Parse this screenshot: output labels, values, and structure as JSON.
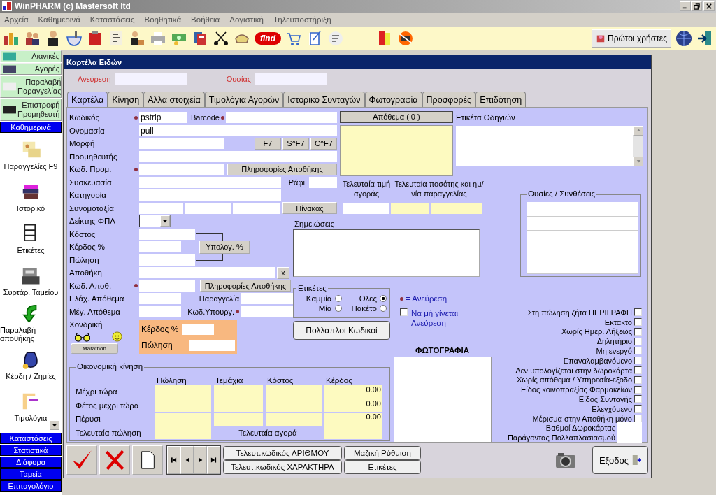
{
  "window": {
    "title": "WinPHARM (c) Mastersoft ltd"
  },
  "menu": [
    "Αρχεία",
    "Καθημερινά",
    "Καταστάσεις",
    "Βοηθητικά",
    "Βοήθεια",
    "Λογιστική",
    "Τηλευποστήριξη"
  ],
  "toolbar": {
    "find_button": "find",
    "first_users_button": "Πρώτοι χρήστες"
  },
  "sidebar": {
    "quick_buttons": [
      "Λιανικές",
      "Αγορές",
      "Παραλαβή Παραγγελίας",
      "Επιστροφή Προμηθευτή"
    ],
    "groups": [
      {
        "label": "Καθημερινά",
        "items": [
          "Παραγγελίες F9",
          "Ιστορικό",
          "Ετικέτες",
          "Συρτάρι Ταμείου",
          "Παραλαβή αποθήκης",
          "Κέρδη / Ζημίες",
          "Τιμολόγια"
        ]
      },
      {
        "label": "Καταστάσεις"
      },
      {
        "label": "Στατιστικά"
      },
      {
        "label": "Διάφορα"
      },
      {
        "label": "Ταμεία"
      },
      {
        "label": "Επιταγολόγιο"
      }
    ]
  },
  "form": {
    "title": "Καρτέλα Ειδών",
    "search": [
      {
        "label": "Ανεύρεση"
      },
      {
        "label": "Ουσίας"
      }
    ],
    "tabs": [
      {
        "label": "Καρτέλα",
        "selected": true
      },
      {
        "label": "Κίνηση",
        "selected": false
      },
      {
        "label": "Αλλα στοιχεία",
        "selected": false
      },
      {
        "label": "Τιμολόγια Αγορών",
        "selected": false
      },
      {
        "label": "Ιστορικό Συνταγών",
        "selected": false
      },
      {
        "label": "Φωτογραφία",
        "selected": false
      },
      {
        "label": "Προσφορές",
        "selected": false
      },
      {
        "label": "Επιδότηση",
        "selected": false
      }
    ]
  },
  "card": {
    "code": {
      "label": "Κωδικός",
      "value": "pstrip",
      "search_key": true
    },
    "barcode": {
      "label": "Barcode",
      "search_key": true
    },
    "name": {
      "label": "Ονομασία",
      "value": "pull"
    },
    "form_field": {
      "label": "Μορφή"
    },
    "form_buttons": [
      "F7",
      "S^F7",
      "C^F7"
    ],
    "supplier": {
      "label": "Προμηθευτής"
    },
    "supplier_code": {
      "label": "Κωδ. Προμ.",
      "search_key": true
    },
    "warehouse_info_button": "Πληροφορίες Αποθήκης",
    "packaging": {
      "label": "Συσκευασία"
    },
    "shelf": {
      "label": "Ράφι"
    },
    "category": {
      "label": "Κατηγορία"
    },
    "class": {
      "label": "Συνομοταξία"
    },
    "table_button": "Πίνακας",
    "vat": {
      "label": "Δείκτης ΦΠΑ"
    },
    "cost": {
      "label": "Κόστος"
    },
    "margin": {
      "label": "Κέρδος %"
    },
    "price": {
      "label": "Πώληση"
    },
    "calc_button": "Υπολογ. %",
    "warehouse": {
      "label": "Αποθήκη",
      "clear_button": "x"
    },
    "warehouse_code": {
      "label": "Κωδ. Αποθ.",
      "search_key": true
    },
    "warehouse_info_button_2": "Πληροφορίες Αποθήκης",
    "min_stock": {
      "label": "Ελάχ. Απόθεμα"
    },
    "order": {
      "label": "Παραγγελία"
    },
    "max_stock": {
      "label": "Μέγ. Απόθεμα"
    },
    "ministry_code": {
      "label": "Κωδ.Υπουργ.",
      "search_key": true
    },
    "wholesale": {
      "label": "Χονδρική",
      "margin_label": "Κέρδος %",
      "price_label": "Πώληση"
    },
    "marathon_button": "Marathon",
    "stock": {
      "label": "Απόθεμα ( 0 )"
    },
    "instructions": {
      "label": "Ετικέτα Οδηγιών"
    },
    "last_price": {
      "label": "Τελευταία τιμή αγοράς"
    },
    "last_order": {
      "label": "Τελευταία ποσότης και ημ/νία παραγγελίας"
    },
    "notes": {
      "label": "Σημειώσεις"
    },
    "labels_group": {
      "title": "Ετικέτες",
      "options": [
        {
          "label": "Καμμία",
          "selected": false
        },
        {
          "label": "Ολες",
          "selected": true
        },
        {
          "label": "Μία",
          "selected": false
        },
        {
          "label": "Πακέτο",
          "selected": false
        }
      ]
    },
    "legend": "= Ανεύρεση",
    "no_search": {
      "label": "Να μή γίνεται Ανεύρεση",
      "checked": false
    },
    "multi_codes_button": "Πολλαπλοί Κωδικοί",
    "substances": {
      "title": "Ουσίες / Συνθέσεις"
    },
    "photo": {
      "title": "ΦΩΤΟΓΡΑΦΙΑ"
    },
    "flags": [
      {
        "label": "Στη πώληση ζήτα ΠΕΡΙΓΡΑΦΗ",
        "checked": false
      },
      {
        "label": "Εκτακτο",
        "checked": false
      },
      {
        "label": "Χωρίς Ημερ. Λήξεως",
        "checked": false
      },
      {
        "label": "Δηλητήριο",
        "checked": false
      },
      {
        "label": "Μη ενεργό",
        "checked": false
      },
      {
        "label": "Επαναλαμβανόμενο",
        "checked": false
      },
      {
        "label": "Δεν υπολογίζεται στην δωροκάρτα",
        "checked": false
      },
      {
        "label": "Χωρίς απόθεμα / Υπηρεσία-εξοδο",
        "checked": false
      },
      {
        "label": "Είδος κοινοπραξίας Φαρμακείων",
        "checked": false
      },
      {
        "label": "Είδος Συνταγής",
        "checked": false
      },
      {
        "label": "Ελεγχόμενο",
        "checked": false
      },
      {
        "label": "Μέρισμα στην Αποθήκη μόνο",
        "checked": false
      }
    ],
    "points": {
      "label": "Βαθμοί Δωροκάρτας"
    },
    "multiplier": {
      "label": "Παράγοντας Πολλαπλασιασμού"
    },
    "finance": {
      "title": "Οικονομική κίνηση",
      "columns": [
        "Πώληση",
        "Τεμάχια",
        "Κόστος",
        "Κέρδος"
      ],
      "rows": [
        {
          "label": "Μέχρι τώρα",
          "profit": "0.00"
        },
        {
          "label": "Φέτος μεχρι τώρα",
          "profit": "0.00"
        },
        {
          "label": "Πέρυσι",
          "profit": "0.00"
        }
      ],
      "last_sale": "Τελευταία πώληση",
      "last_purchase": "Τελευταία αγορά"
    }
  },
  "actions": {
    "buttons": [
      "Τελευτ.κωδικός ΑΡΙΘΜΟΥ",
      "Τελευτ.κωδικός ΧΑΡΑΚΤΗΡΑ",
      "Μαζική Ρύθμιση",
      "Ετικέτες"
    ],
    "exit": "Εξοδος"
  }
}
